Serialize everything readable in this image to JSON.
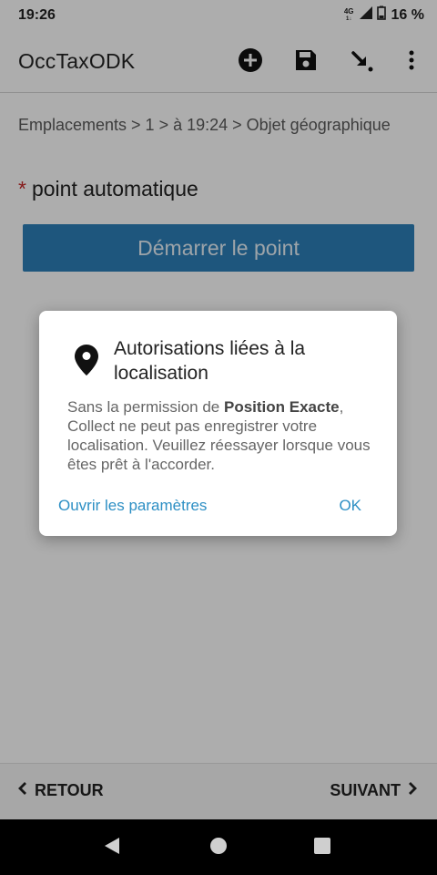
{
  "status_bar": {
    "time": "19:26",
    "network": "4G",
    "network_sub": "1↓",
    "battery": "16 %"
  },
  "app_bar": {
    "title": "OccTaxODK",
    "icons": [
      "add-circle-icon",
      "save-icon",
      "arrow-down-right-icon",
      "more-vert-icon"
    ]
  },
  "form": {
    "breadcrumb": "Emplacements > 1 > à 19:24 > Objet géographique",
    "required_marker": "*",
    "question_label": "point automatique",
    "start_button": "Démarrer le point"
  },
  "dialog": {
    "icon": "location-pin-icon",
    "title": "Autorisations liées à la localisation",
    "body_prefix": "Sans la permission de ",
    "body_bold": "Position Exacte",
    "body_suffix": ", Collect ne peut pas enregistrer votre localisation. Veuillez réessayer lorsque vous êtes prêt à l'accorder.",
    "settings_button": "Ouvrir les paramètres",
    "ok_button": "OK"
  },
  "bottom_nav": {
    "back_label": "RETOUR",
    "next_label": "SUIVANT"
  },
  "colors": {
    "accent": "#2d7fb8",
    "link": "#2d8fc4",
    "required": "#c62828"
  }
}
